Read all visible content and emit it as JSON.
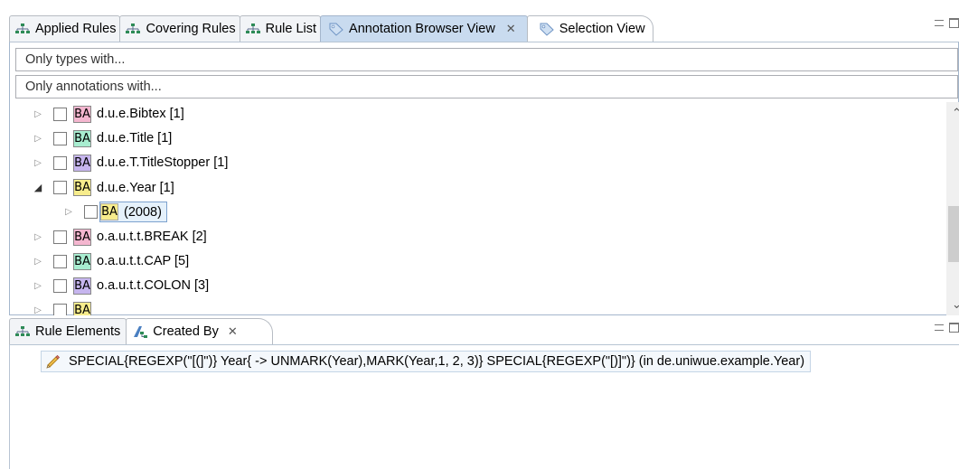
{
  "top_tabs": [
    {
      "label": "Applied Rules",
      "icon": "rule-tree-icon"
    },
    {
      "label": "Covering Rules",
      "icon": "rule-tree-icon"
    },
    {
      "label": "Rule List",
      "icon": "rule-tree-icon"
    },
    {
      "label": "Annotation Browser View",
      "icon": "tag-icon",
      "active": true,
      "close": "✕"
    },
    {
      "label": "Selection View",
      "icon": "tag-icon"
    }
  ],
  "filters": {
    "types_placeholder": "Only types with...",
    "annotations_placeholder": "Only annotations with..."
  },
  "badge_text": "BA",
  "tree_rows": [
    {
      "label": "d.u.e.Bibtex [1]",
      "color": "#f4b6cf",
      "expanded": false
    },
    {
      "label": "d.u.e.Title [1]",
      "color": "#a8edd0",
      "expanded": false
    },
    {
      "label": "d.u.e.T.TitleStopper [1]",
      "color": "#c6b5ee",
      "expanded": false
    },
    {
      "label": "d.u.e.Year [1]",
      "color": "#f7ec8c",
      "expanded": true
    },
    {
      "label": "(2008)",
      "color": "#f7ec8c",
      "child": true,
      "selected": true
    },
    {
      "label": "o.a.u.t.t.BREAK [2]",
      "color": "#f4b6cf",
      "expanded": false
    },
    {
      "label": "o.a.u.t.t.CAP [5]",
      "color": "#a8edd0",
      "expanded": false
    },
    {
      "label": "o.a.u.t.t.COLON [3]",
      "color": "#c6b5ee",
      "expanded": false
    },
    {
      "label": "",
      "color": "#f7ec8c",
      "expanded": false
    }
  ],
  "bottom_tabs": [
    {
      "label": "Rule Elements",
      "icon": "rule-tree-icon"
    },
    {
      "label": "Created By",
      "icon": "created-by-icon",
      "active": true,
      "close": "✕"
    }
  ],
  "created_by": {
    "text": "SPECIAL{REGEXP(\"[(]\")} Year{ -> UNMARK(Year),MARK(Year,1, 2, 3)} SPECIAL{REGEXP(\"[)]\")}  (in de.uniwue.example.Year)",
    "icon": "pencil-icon"
  }
}
